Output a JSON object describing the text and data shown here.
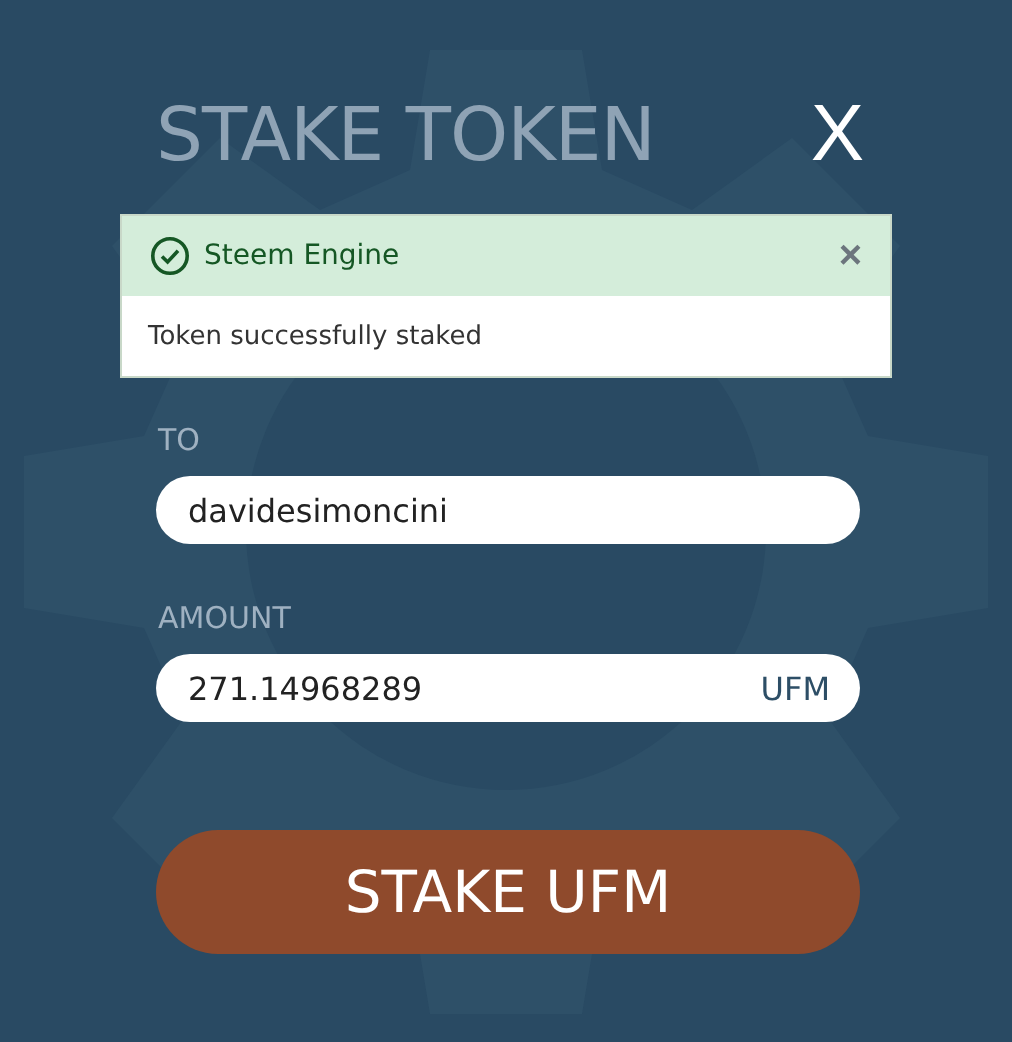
{
  "dialog": {
    "title": "STAKE TOKEN",
    "close": "X"
  },
  "toast": {
    "title": "Steem Engine",
    "close": "×",
    "message": "Token successfully staked"
  },
  "fields": [
    {
      "label": "TO",
      "value": "davidesimoncini"
    },
    {
      "label": "AMOUNT",
      "value": "271.14968289",
      "suffix": "UFM"
    }
  ],
  "submit": "STAKE UFM"
}
